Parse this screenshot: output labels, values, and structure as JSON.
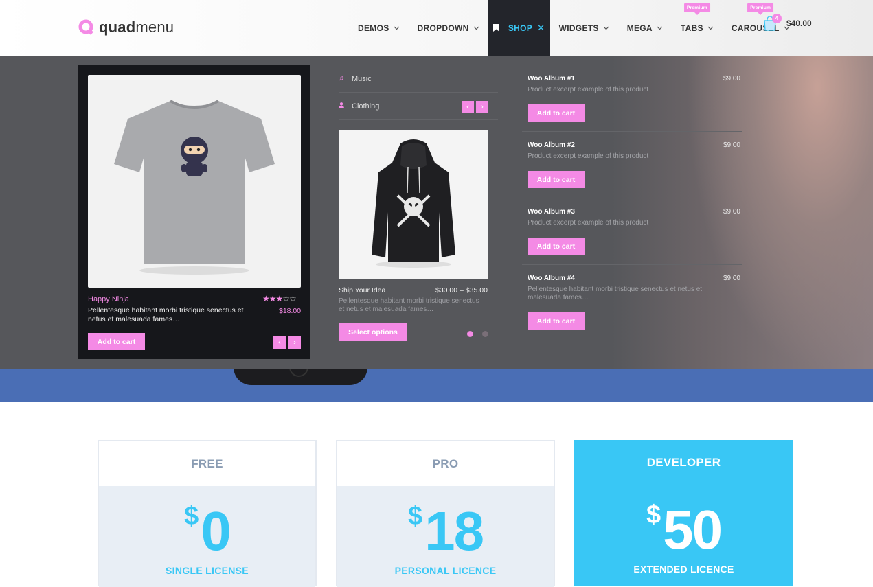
{
  "brand": {
    "name_bold": "quad",
    "name_light": "menu",
    "accent": "#f48ae5"
  },
  "nav": {
    "items": [
      {
        "label": "DEMOS",
        "icon": "chevron-down-icon"
      },
      {
        "label": "DROPDOWN",
        "icon": "chevron-down-icon"
      },
      {
        "label": "SHOP",
        "icon": "close-icon",
        "active": true
      },
      {
        "label": "WIDGETS",
        "icon": "chevron-down-icon"
      },
      {
        "label": "MEGA",
        "icon": "chevron-down-icon"
      },
      {
        "label": "TABS",
        "icon": "chevron-down-icon",
        "badge": "Premium"
      },
      {
        "label": "CAROUSEL",
        "icon": "chevron-down-icon",
        "badge": "Premium"
      }
    ],
    "active_color": "#39c7f5",
    "close_glyph": "✕"
  },
  "cart": {
    "count": "4",
    "total": "$40.00"
  },
  "featured": {
    "name": "Happy Ninja",
    "rating": 3,
    "rating_max": 5,
    "description": "Pellentesque habitant morbi tristique senectus et netus et malesuada fames…",
    "price": "$18.00",
    "button": "Add to cart",
    "prev": "‹",
    "next": "›"
  },
  "categories": [
    {
      "label": "Music",
      "icon": "music-icon"
    },
    {
      "label": "Clothing",
      "icon": "user-icon"
    }
  ],
  "carousel": {
    "name": "Ship Your Idea",
    "price": "$30.00 – $35.00",
    "description": "Pellentesque habitant morbi tristique senectus et netus et malesuada fames…",
    "button": "Select options",
    "prev": "‹",
    "next": "›"
  },
  "albums": [
    {
      "title": "Woo Album #1",
      "price": "$9.00",
      "desc": "Product excerpt example of this product",
      "button": "Add to cart"
    },
    {
      "title": "Woo Album #2",
      "price": "$9.00",
      "desc": "Product excerpt example of this product",
      "button": "Add to cart"
    },
    {
      "title": "Woo Album #3",
      "price": "$9.00",
      "desc": "Product excerpt example of this product",
      "button": "Add to cart"
    },
    {
      "title": "Woo Album #4",
      "price": "$9.00",
      "desc": "Pellentesque habitant morbi tristique senectus et netus et malesuada fames…",
      "button": "Add to cart"
    }
  ],
  "pricing": [
    {
      "name": "FREE",
      "currency": "$",
      "amount": "0",
      "license": "SINGLE LICENSE"
    },
    {
      "name": "PRO",
      "currency": "$",
      "amount": "18",
      "license": "PERSONAL LICENCE"
    },
    {
      "name": "DEVELOPER",
      "currency": "$",
      "amount": "50",
      "license": "EXTENDED LICENCE"
    }
  ]
}
